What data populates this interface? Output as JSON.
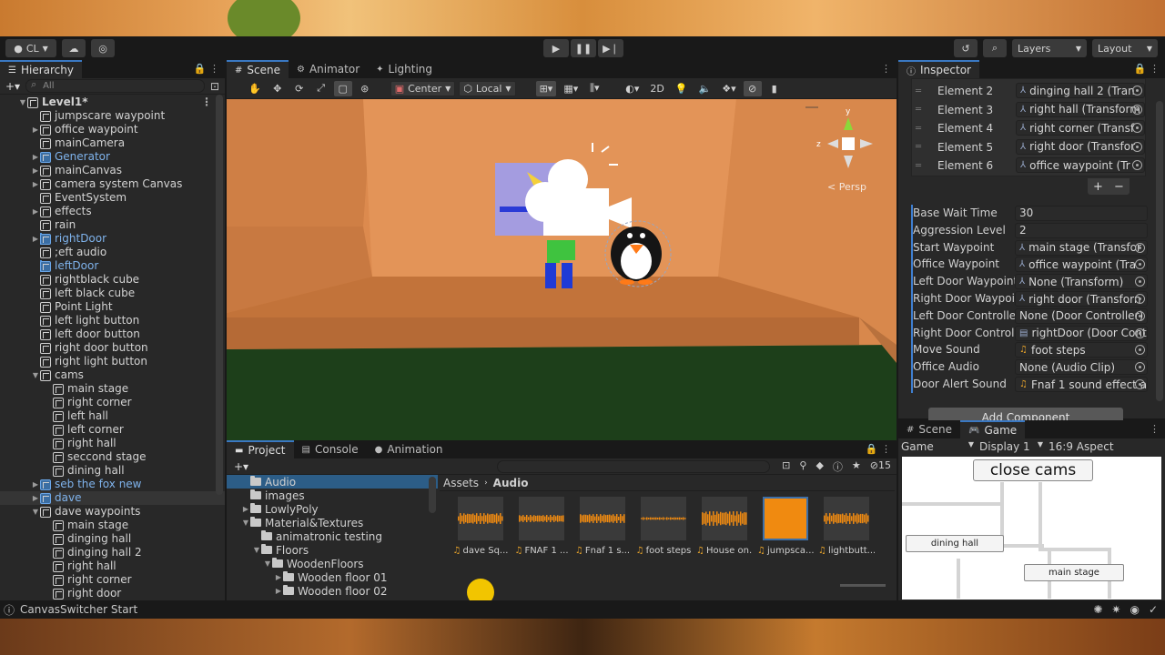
{
  "toolbar": {
    "account": "CL",
    "layers_label": "Layers",
    "layout_label": "Layout"
  },
  "hierarchy": {
    "tab": "Hierarchy",
    "search_placeholder": "All",
    "items": [
      {
        "label": "Level1*",
        "depth": 0,
        "arrow": "▼",
        "type": "scene"
      },
      {
        "label": "jumpscare waypoint",
        "depth": 1,
        "arrow": "",
        "type": "obj"
      },
      {
        "label": "office waypoint",
        "depth": 1,
        "arrow": "▶",
        "type": "obj"
      },
      {
        "label": "mainCamera",
        "depth": 1,
        "arrow": "",
        "type": "obj"
      },
      {
        "label": "Generator",
        "depth": 1,
        "arrow": "▶",
        "type": "prefab"
      },
      {
        "label": "mainCanvas",
        "depth": 1,
        "arrow": "▶",
        "type": "obj"
      },
      {
        "label": "camera system Canvas",
        "depth": 1,
        "arrow": "▶",
        "type": "obj"
      },
      {
        "label": "EventSystem",
        "depth": 1,
        "arrow": "",
        "type": "obj"
      },
      {
        "label": "effects",
        "depth": 1,
        "arrow": "▶",
        "type": "obj"
      },
      {
        "label": "rain",
        "depth": 1,
        "arrow": "",
        "type": "obj"
      },
      {
        "label": "rightDoor",
        "depth": 1,
        "arrow": "▶",
        "type": "prefab",
        "marker": true
      },
      {
        "label": ";eft audio",
        "depth": 1,
        "arrow": "",
        "type": "obj"
      },
      {
        "label": "leftDoor",
        "depth": 1,
        "arrow": "",
        "type": "prefab",
        "marker": true
      },
      {
        "label": "rightblack cube",
        "depth": 1,
        "arrow": "",
        "type": "obj"
      },
      {
        "label": "left black cube",
        "depth": 1,
        "arrow": "",
        "type": "obj"
      },
      {
        "label": "Point Light",
        "depth": 1,
        "arrow": "",
        "type": "obj"
      },
      {
        "label": "left light button",
        "depth": 1,
        "arrow": "",
        "type": "obj"
      },
      {
        "label": "left door button",
        "depth": 1,
        "arrow": "",
        "type": "obj"
      },
      {
        "label": "right door button",
        "depth": 1,
        "arrow": "",
        "type": "obj"
      },
      {
        "label": "right  light button",
        "depth": 1,
        "arrow": "",
        "type": "obj"
      },
      {
        "label": "cams",
        "depth": 1,
        "arrow": "▼",
        "type": "obj"
      },
      {
        "label": "main stage",
        "depth": 2,
        "arrow": "",
        "type": "obj"
      },
      {
        "label": "right corner",
        "depth": 2,
        "arrow": "",
        "type": "obj"
      },
      {
        "label": "left hall",
        "depth": 2,
        "arrow": "",
        "type": "obj"
      },
      {
        "label": "left corner",
        "depth": 2,
        "arrow": "",
        "type": "obj"
      },
      {
        "label": "right hall",
        "depth": 2,
        "arrow": "",
        "type": "obj"
      },
      {
        "label": "seccond stage",
        "depth": 2,
        "arrow": "",
        "type": "obj"
      },
      {
        "label": "dining hall",
        "depth": 2,
        "arrow": "",
        "type": "obj"
      },
      {
        "label": "seb the fox new",
        "depth": 1,
        "arrow": "▶",
        "type": "prefab"
      },
      {
        "label": "dave",
        "depth": 1,
        "arrow": "▶",
        "type": "prefab",
        "selected": true
      },
      {
        "label": "dave waypoints",
        "depth": 1,
        "arrow": "▼",
        "type": "obj"
      },
      {
        "label": "main stage",
        "depth": 2,
        "arrow": "",
        "type": "obj"
      },
      {
        "label": "dinging hall",
        "depth": 2,
        "arrow": "",
        "type": "obj"
      },
      {
        "label": "dinging hall  2",
        "depth": 2,
        "arrow": "",
        "type": "obj"
      },
      {
        "label": "right hall",
        "depth": 2,
        "arrow": "",
        "type": "obj"
      },
      {
        "label": "right corner",
        "depth": 2,
        "arrow": "",
        "type": "obj"
      },
      {
        "label": "right door",
        "depth": 2,
        "arrow": "",
        "type": "obj"
      }
    ]
  },
  "scene": {
    "tabs": [
      "Scene",
      "Animator",
      "Lighting"
    ],
    "pivot": "Center",
    "space": "Local",
    "mode_2d": "2D",
    "persp_label": "< Persp"
  },
  "inspector": {
    "tab": "Inspector",
    "elements": [
      {
        "label": "Element 2",
        "value": "dinging hall  2 (Tran"
      },
      {
        "label": "Element 3",
        "value": "right hall (Transform"
      },
      {
        "label": "Element 4",
        "value": "right corner (Transf"
      },
      {
        "label": "Element 5",
        "value": "right door (Transfor"
      },
      {
        "label": "Element 6",
        "value": "office waypoint (Tr"
      }
    ],
    "props": [
      {
        "label": "Base Wait Time",
        "value": "30",
        "kind": "text"
      },
      {
        "label": "Aggression Level",
        "value": "2",
        "kind": "text"
      },
      {
        "label": "Start Waypoint",
        "value": "main stage (Transfor",
        "kind": "obj",
        "icon": "⅄"
      },
      {
        "label": "Office Waypoint",
        "value": "office waypoint (Tra",
        "kind": "obj",
        "icon": "⅄"
      },
      {
        "label": "Left Door Waypoint",
        "value": "None (Transform)",
        "kind": "obj",
        "icon": "⅄"
      },
      {
        "label": "Right Door Waypoint",
        "value": "right door (Transforn",
        "kind": "obj",
        "icon": "⅄"
      },
      {
        "label": "Left Door Controller",
        "value": "None (Door Controller)",
        "kind": "obj",
        "icon": ""
      },
      {
        "label": "Right Door Controlle",
        "value": "rightDoor (Door Cont",
        "kind": "obj",
        "icon": "▤"
      },
      {
        "label": "Move Sound",
        "value": "foot steps",
        "kind": "obj",
        "icon": "♫"
      },
      {
        "label": "Office Audio",
        "value": "None (Audio Clip)",
        "kind": "obj",
        "icon": ""
      },
      {
        "label": "Door Alert Sound",
        "value": "Fnaf 1 sound effect a",
        "kind": "obj",
        "icon": "♫"
      }
    ],
    "add_component": "Add Component"
  },
  "game": {
    "tabs": [
      "Scene",
      "Game"
    ],
    "mode": "Game",
    "display": "Display 1",
    "aspect": "16:9 Aspect",
    "close_cams": "close cams",
    "dining_hall": "dining hall",
    "main_stage": "main stage"
  },
  "project": {
    "tabs": [
      "Project",
      "Console",
      "Animation"
    ],
    "badge_count": "15",
    "folders": [
      {
        "label": "Audio",
        "depth": 1,
        "arrow": "",
        "selected": true
      },
      {
        "label": "images",
        "depth": 1,
        "arrow": ""
      },
      {
        "label": "LowlyPoly",
        "depth": 1,
        "arrow": "▶"
      },
      {
        "label": "Material&Textures",
        "depth": 1,
        "arrow": "▼"
      },
      {
        "label": "animatronic testing",
        "depth": 2,
        "arrow": ""
      },
      {
        "label": "Floors",
        "depth": 2,
        "arrow": "▼"
      },
      {
        "label": "WoodenFloors",
        "depth": 3,
        "arrow": "▼"
      },
      {
        "label": "Wooden floor 01",
        "depth": 4,
        "arrow": "▶"
      },
      {
        "label": "Wooden floor 02",
        "depth": 4,
        "arrow": "▶"
      }
    ],
    "breadcrumb": [
      "Assets",
      "Audio"
    ],
    "assets": [
      {
        "label": "dave Sq..."
      },
      {
        "label": "FNAF 1 ..."
      },
      {
        "label": "Fnaf 1 s..."
      },
      {
        "label": "foot steps"
      },
      {
        "label": "House on..."
      },
      {
        "label": "jumpsca..."
      },
      {
        "label": "lightbutt..."
      }
    ]
  },
  "status": {
    "message": "CanvasSwitcher Start"
  }
}
